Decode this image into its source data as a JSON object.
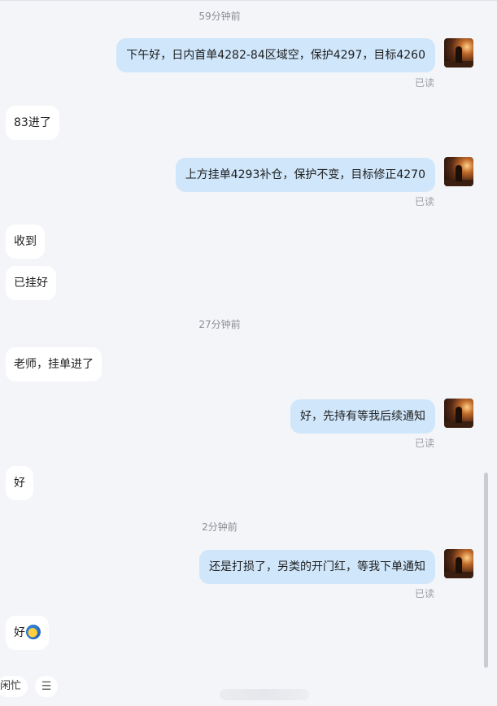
{
  "timestamps": [
    "59分钟前",
    "27分钟前",
    "2分钟前"
  ],
  "messages": [
    {
      "text": "下午好，日内首单4282-84区域空，保护4297，目标4260",
      "read": "已读"
    },
    {
      "text": "83进了"
    },
    {
      "text": "上方挂单4293补仓，保护不变，目标修正4270",
      "read": "已读"
    },
    {
      "text": "收到"
    },
    {
      "text": "已挂好"
    },
    {
      "text": "老师，挂单进了"
    },
    {
      "text": "好，先持有等我后续通知",
      "read": "已读"
    },
    {
      "text": "好"
    },
    {
      "text": "还是打损了，另类的开门红，等我下单通知",
      "read": "已读"
    },
    {
      "text": "好"
    }
  ],
  "footer": {
    "status": "闲忙",
    "menu_icon": "☰"
  },
  "icons": {
    "avatar": "avatar-sunset-figure",
    "emoji": "satellite-emoji-icon"
  },
  "colors": {
    "incoming_bubble": "#ffffff",
    "outgoing_bubble": "#cfe6fb",
    "background": "#f4f5f8"
  }
}
